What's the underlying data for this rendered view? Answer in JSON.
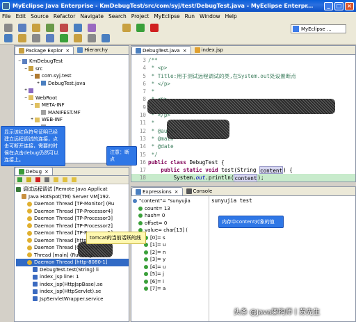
{
  "window": {
    "title": "MyEclipse Java Enterprise - KmDebugTest/src/com/syj/test/DebugTest.java - MyEclipse Enterpr...",
    "min": "_",
    "max": "□",
    "close": "×"
  },
  "menu": [
    "File",
    "Edit",
    "Source",
    "Refactor",
    "Navigate",
    "Search",
    "Project",
    "MyEclipse",
    "Run",
    "Window",
    "Help"
  ],
  "toolbar": {
    "perspective_label": "MyEclipse ..."
  },
  "package_explorer": {
    "tabs": [
      "Package Explor",
      "Hierarchy"
    ],
    "tree": [
      {
        "indent": 0,
        "twisty": "−",
        "icon": "project-icon",
        "label": "KmDebugTest"
      },
      {
        "indent": 1,
        "twisty": "−",
        "icon": "src-folder-icon",
        "label": "src"
      },
      {
        "indent": 2,
        "twisty": "−",
        "icon": "package-icon",
        "label": "com.syj.test"
      },
      {
        "indent": 3,
        "twisty": "+",
        "icon": "java-file-icon",
        "label": "DebugTest.java"
      },
      {
        "indent": 1,
        "twisty": "+",
        "icon": "library-icon",
        "label": ""
      },
      {
        "indent": 1,
        "twisty": "−",
        "icon": "folder-icon",
        "label": "WebRoot"
      },
      {
        "indent": 2,
        "twisty": "−",
        "icon": "folder-icon",
        "label": "META-INF"
      },
      {
        "indent": 3,
        "twisty": "",
        "icon": "file-icon",
        "label": "MANIFEST.MF"
      },
      {
        "indent": 2,
        "twisty": "+",
        "icon": "folder-icon",
        "label": "WEB-INF"
      },
      {
        "indent": 3,
        "twisty": "",
        "icon": "file-icon",
        "label": ""
      },
      {
        "indent": 3,
        "twisty": "",
        "icon": "file-icon",
        "label": "..xml"
      },
      {
        "indent": 3,
        "twisty": "",
        "icon": "file-icon",
        "label": "..m"
      }
    ]
  },
  "editor": {
    "tabs": [
      "DebugTest.java",
      "index.jsp"
    ],
    "lines": [
      {
        "num": "",
        "parts": [
          {
            "t": "/**",
            "c": "com"
          }
        ]
      },
      {
        "num": "",
        "parts": [
          {
            "t": " * <p>",
            "c": "com"
          }
        ]
      },
      {
        "num": "",
        "parts": [
          {
            "t": " * Title:用于测试远程调试的类,在System.out处设置断点",
            "c": "com"
          }
        ]
      },
      {
        "num": "",
        "parts": [
          {
            "t": " * </p>",
            "c": "com"
          }
        ]
      },
      {
        "num": "",
        "parts": [
          {
            "t": " *",
            "c": "com"
          }
        ]
      },
      {
        "num": "",
        "parts": [
          {
            "t": " * <p>",
            "c": "com"
          }
        ]
      },
      {
        "num": "",
        "parts": [
          {
            "t": " *",
            "c": "com"
          }
        ]
      },
      {
        "num": "",
        "parts": [
          {
            "t": " * </p>",
            "c": "com"
          }
        ]
      },
      {
        "num": "",
        "parts": [
          {
            "t": " *",
            "c": "com"
          }
        ]
      },
      {
        "num": "",
        "parts": [
          {
            "t": " * @autho",
            "c": "com"
          }
        ]
      },
      {
        "num": "",
        "parts": [
          {
            "t": " * @main",
            "c": "com"
          }
        ]
      },
      {
        "num": "",
        "parts": [
          {
            "t": " * @date",
            "c": "com"
          }
        ]
      },
      {
        "num": "",
        "parts": [
          {
            "t": " */",
            "c": "com"
          }
        ]
      },
      {
        "num": "",
        "parts": [
          {
            "t": "public class ",
            "c": "kw"
          },
          {
            "t": "DebugTest {",
            "c": ""
          }
        ]
      },
      {
        "num": "",
        "parts": [
          {
            "t": "    public static void ",
            "c": "kw"
          },
          {
            "t": "test(String ",
            "c": ""
          },
          {
            "t": "content",
            "c": "hl"
          },
          {
            "t": ") {",
            "c": ""
          }
        ]
      },
      {
        "num": "",
        "parts": [
          {
            "t": "        System.",
            "c": ""
          },
          {
            "t": "out",
            "c": "fld"
          },
          {
            "t": ".println(",
            "c": ""
          },
          {
            "t": "content",
            "c": "hl"
          },
          {
            "t": ");",
            "c": ""
          }
        ]
      },
      {
        "num": "",
        "parts": [
          {
            "t": "    }",
            "c": ""
          }
        ]
      }
    ],
    "line_numbers": [
      "3",
      "4",
      "5",
      "6",
      "7",
      "8",
      "9",
      "10",
      "11",
      "12",
      "13",
      "14",
      "15",
      "16",
      "17",
      "18",
      "19"
    ]
  },
  "debug": {
    "tab_label": "Debug",
    "tree": [
      {
        "indent": 0,
        "icon": "app-icon",
        "label": "调试远程调试 [Remote Java Applicat"
      },
      {
        "indent": 1,
        "icon": "vm-icon",
        "label": "Java HotSpot(TM) Server VM[192."
      },
      {
        "indent": 2,
        "icon": "thread-icon",
        "label": "Daemon Thread [TP-Monitor] (Ru"
      },
      {
        "indent": 2,
        "icon": "thread-icon",
        "label": "Daemon Thread [TP-Processor4]"
      },
      {
        "indent": 2,
        "icon": "thread-icon",
        "label": "Daemon Thread [TP-Processor3]"
      },
      {
        "indent": 2,
        "icon": "thread-icon",
        "label": "Daemon Thread [TP-Processor2]"
      },
      {
        "indent": 2,
        "icon": "thread-icon",
        "label": "Daemon Thread [TP-Processor1]"
      },
      {
        "indent": 2,
        "icon": "thread-icon",
        "label": "Daemon Thread [http-8080-"
      },
      {
        "indent": 2,
        "icon": "thread-icon",
        "label": "Daemon Thread [Container"
      },
      {
        "indent": 2,
        "icon": "thread-icon",
        "label": "Thread [main] (Running)"
      },
      {
        "indent": 2,
        "icon": "thread-suspended-icon",
        "label": "Daemon Thread [http-8080-1]",
        "selected": true
      },
      {
        "indent": 3,
        "icon": "frame-icon",
        "label": "DebugTest.test(String) li"
      },
      {
        "indent": 3,
        "icon": "frame-icon",
        "label": "index_jsp line: 1"
      },
      {
        "indent": 3,
        "icon": "frame-icon",
        "label": "index_jsp(HttpJspBase).se"
      },
      {
        "indent": 3,
        "icon": "frame-icon",
        "label": "index_jsp(HttpServlet).se"
      },
      {
        "indent": 3,
        "icon": "frame-icon",
        "label": "JspServletWrapper.service"
      }
    ]
  },
  "expressions": {
    "tabs": [
      "Expressions",
      "Console"
    ],
    "tree": [
      {
        "indent": 0,
        "label": "\"content\"= \"sunyujia"
      },
      {
        "indent": 1,
        "label": "count= 13"
      },
      {
        "indent": 1,
        "label": "hash= 0"
      },
      {
        "indent": 1,
        "label": "offset= 0"
      },
      {
        "indent": 1,
        "label": "value= char[13]  ("
      },
      {
        "indent": 2,
        "label": "[0]= s"
      },
      {
        "indent": 2,
        "label": "[1]= u"
      },
      {
        "indent": 2,
        "label": "[2]= n"
      },
      {
        "indent": 2,
        "label": "[3]= y"
      },
      {
        "indent": 2,
        "label": "[4]= u"
      },
      {
        "indent": 2,
        "label": "[5]= j"
      },
      {
        "indent": 2,
        "label": "[6]= i"
      },
      {
        "indent": 2,
        "label": "[7]= a"
      }
    ],
    "console_text": "sunyujia test"
  },
  "callouts": {
    "connection": "显示该红色符号证明已经建立远程调试的连接，点击可断开连接，需要的时候在点击debug仍然可以连接上。",
    "breakpoint": "注意：断点",
    "thread": "tomcat的当前活跃的线",
    "content_value": "内存中content对象的值"
  },
  "watermark": "头条 @Java架构师丨苏先生",
  "colors": {
    "title_bar": "#0a5fd8",
    "callout": "#2f77e6",
    "callout_yellow": "#fff8b0",
    "selection": "#316ac5",
    "breakpoint_line": "#c8ebcc",
    "comment": "#3f7f5f",
    "keyword": "#7f0055"
  }
}
